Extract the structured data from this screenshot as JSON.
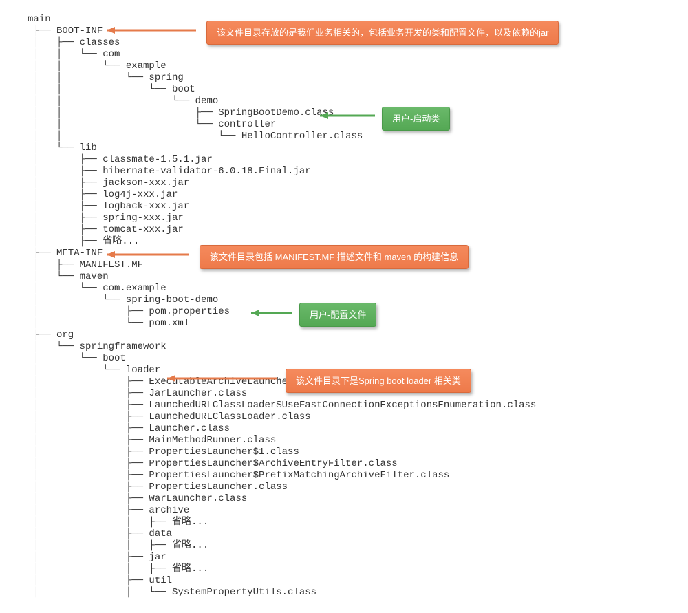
{
  "tree": {
    "root": "main",
    "lines": [
      "main",
      " ├── BOOT-INF",
      " │   ├── classes",
      " │   │   └── com",
      " │   │       └── example",
      " │   │           └── spring",
      " │   │               └── boot",
      " │   │                   └── demo",
      " │   │                       ├── SpringBootDemo.class",
      " │   │                       └── controller",
      " │   │                           └── HelloController.class",
      " │   └── lib",
      " │       ├── classmate-1.5.1.jar",
      " │       ├── hibernate-validator-6.0.18.Final.jar",
      " │       ├── jackson-xxx.jar",
      " │       ├── log4j-xxx.jar",
      " │       ├── logback-xxx.jar",
      " │       ├── spring-xxx.jar",
      " │       ├── tomcat-xxx.jar",
      " │       ├── 省略...",
      " ├── META-INF",
      " │   ├── MANIFEST.MF",
      " │   └── maven",
      " │       └── com.example",
      " │           └── spring-boot-demo",
      " │               ├── pom.properties",
      " │               └── pom.xml",
      " ├── org",
      " │   └── springframework",
      " │       └── boot",
      " │           └── loader",
      " │               ├── ExecutableArchiveLauncher.class",
      " │               ├── JarLauncher.class",
      " │               ├── LaunchedURLClassLoader$UseFastConnectionExceptionsEnumeration.class",
      " │               ├── LaunchedURLClassLoader.class",
      " │               ├── Launcher.class",
      " │               ├── MainMethodRunner.class",
      " │               ├── PropertiesLauncher$1.class",
      " │               ├── PropertiesLauncher$ArchiveEntryFilter.class",
      " │               ├── PropertiesLauncher$PrefixMatchingArchiveFilter.class",
      " │               ├── PropertiesLauncher.class",
      " │               ├── WarLauncher.class",
      " │               ├── archive",
      " │               │   ├── 省略...",
      " │               ├── data",
      " │               │   ├── 省略...",
      " │               ├── jar",
      " │               │   ├── 省略...",
      " │               ├── util",
      " │               │   └── SystemPropertyUtils.class"
    ]
  },
  "callouts": {
    "boot_inf": "该文件目录存放的是我们业务相关的，包括业务开发的类和配置文件，以及依赖的jar",
    "spring_boot_demo": "用户-启动类",
    "meta_inf": "该文件目录包括 MANIFEST.MF 描述文件和 maven 的构建信息",
    "pom_properties": "用户-配置文件",
    "loader": "该文件目录下是Spring boot loader  相关类"
  },
  "colors": {
    "orange_bg": "#f58a5d",
    "green_bg": "#6ab96a",
    "text_dark": "#333333"
  }
}
